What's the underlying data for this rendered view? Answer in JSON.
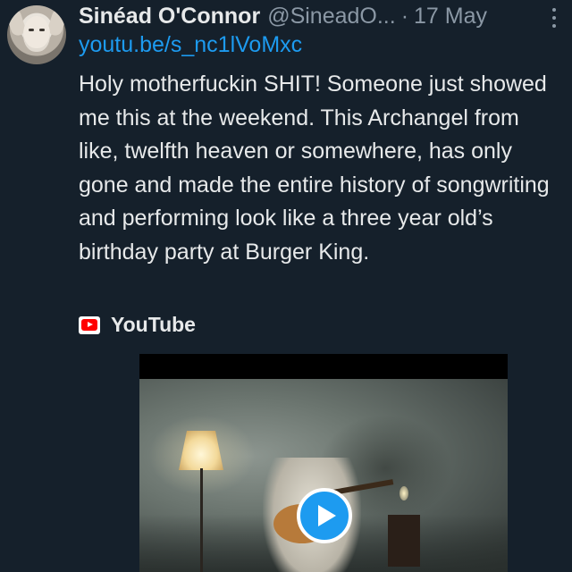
{
  "tweet": {
    "display_name": "Sinéad O'Connor",
    "handle": "@SineadO...",
    "separator": "·",
    "date": "17 May",
    "link": "youtu.be/s_nc1lVoMxc",
    "text": "Holy motherfuckin SHIT! Someone just showed me this at the weekend. This Archangel from like, twelfth heaven or somewhere, has only gone and made the entire history of songwriting and performing look like a three year old’s birthday party at Burger King.",
    "source_label": "YouTube"
  },
  "icons": {
    "more": "more-vertical-icon",
    "source": "youtube-icon",
    "play": "play-icon"
  },
  "colors": {
    "background": "#15202b",
    "text": "#e7e9ea",
    "muted": "#8b98a5",
    "link": "#1d9bf0",
    "play_button": "#1d9bf0",
    "youtube_red": "#ff0000"
  }
}
